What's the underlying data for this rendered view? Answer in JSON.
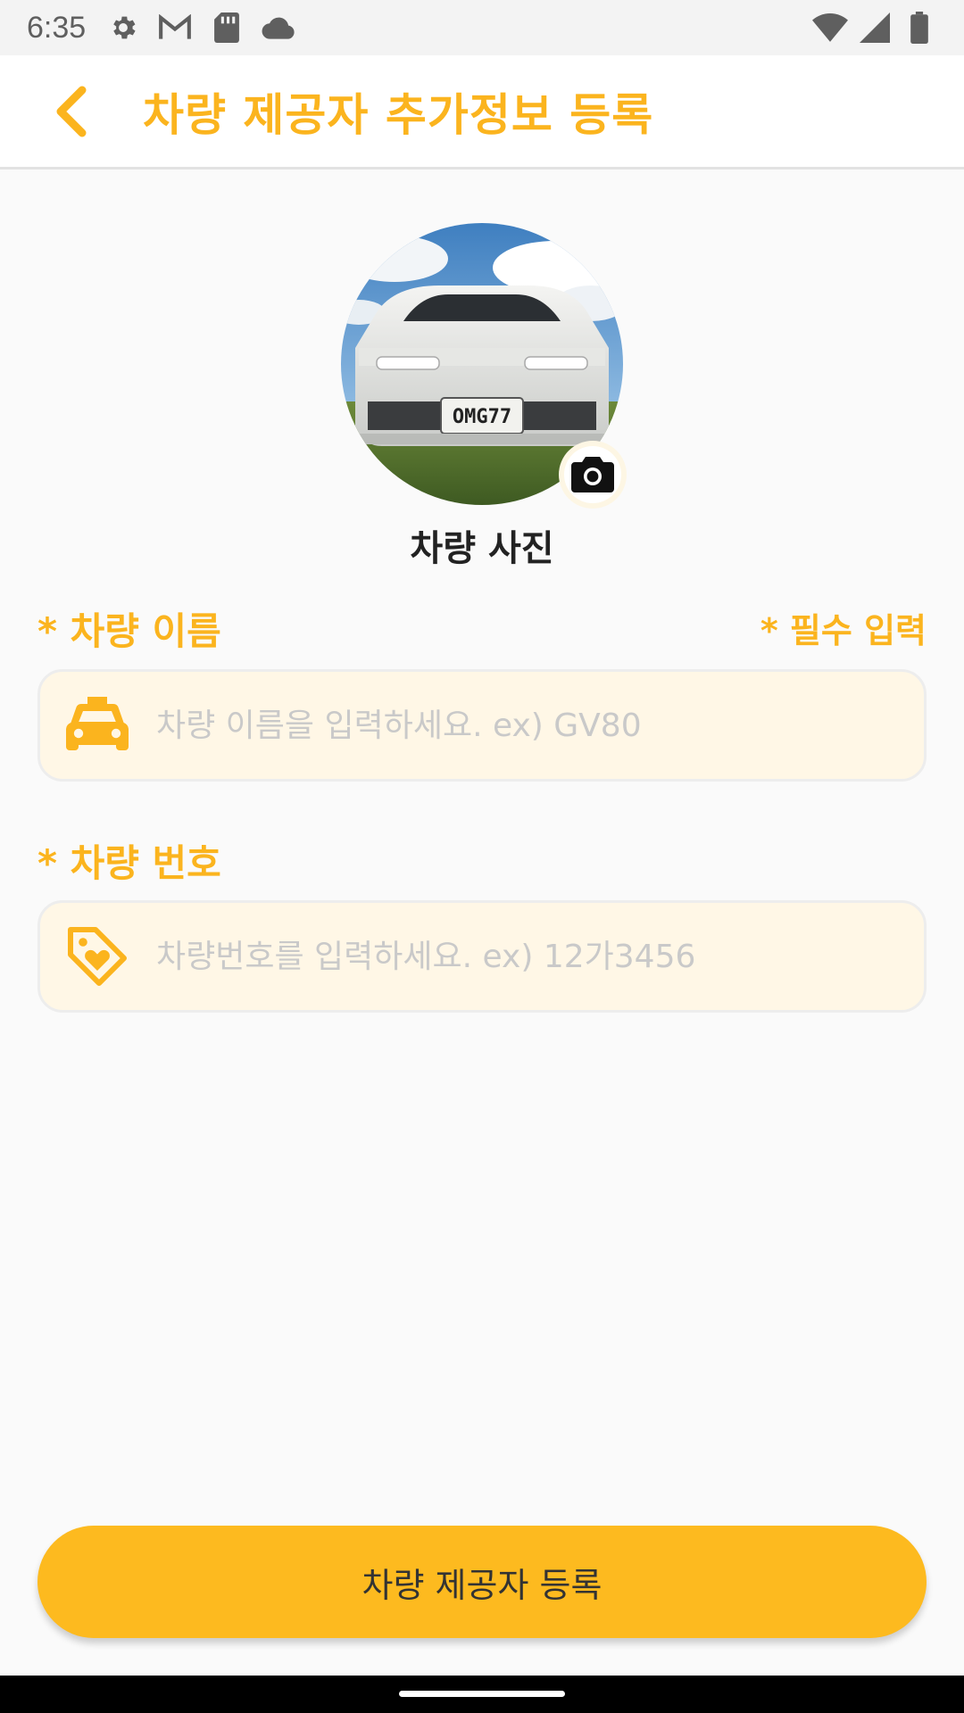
{
  "status_bar": {
    "time": "6:35",
    "left_icons": [
      "settings-icon",
      "gmail-icon",
      "sd-card-icon",
      "cloud-icon"
    ],
    "right_icons": [
      "wifi-icon",
      "cellular-icon",
      "battery-icon"
    ]
  },
  "app_bar": {
    "title": "차량 제공자 추가정보 등록",
    "back_icon": "chevron-left-icon",
    "accent_color": "#fbb41e"
  },
  "photo": {
    "label": "차량 사진",
    "plate_text": "OMG77",
    "camera_icon": "camera-icon"
  },
  "form": {
    "required_note": "* 필수 입력",
    "name_field": {
      "label": "* 차량 이름",
      "placeholder": "차량 이름을 입력하세요. ex) GV80",
      "value": "",
      "icon": "taxi-icon"
    },
    "number_field": {
      "label": "* 차량 번호",
      "placeholder": "차량번호를 입력하세요. ex) 12가3456",
      "value": "",
      "icon": "tag-heart-icon"
    }
  },
  "submit": {
    "label": "차량 제공자 등록",
    "color": "#fdba1f"
  }
}
